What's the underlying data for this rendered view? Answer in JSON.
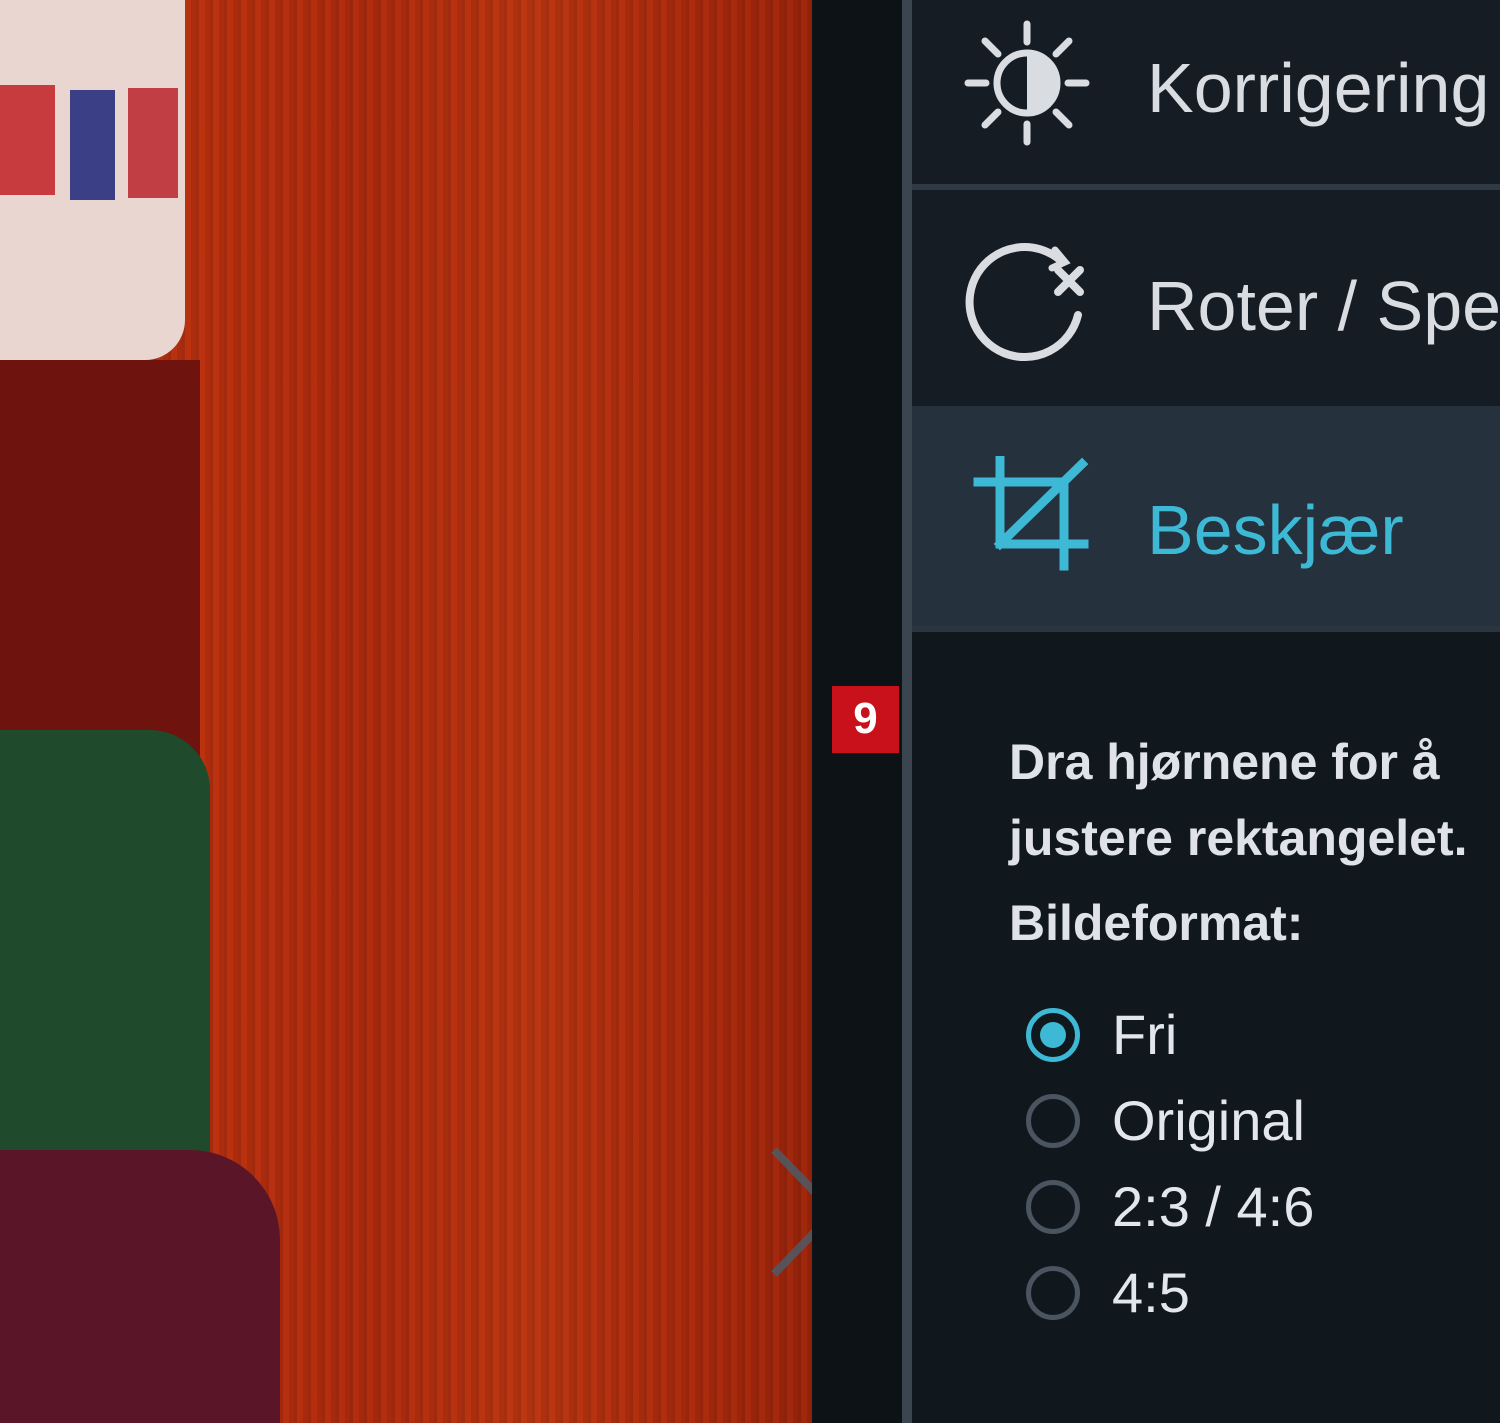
{
  "photo_viewer": {
    "next_icon": "chevron-right-icon"
  },
  "badge": {
    "number": "9",
    "color": "#c8111a"
  },
  "tools": [
    {
      "label": "Korrigering",
      "icon": "brightness-icon",
      "active": false
    },
    {
      "label": "Roter / Speil",
      "icon": "rotate-icon",
      "active": false
    },
    {
      "label": "Beskjær",
      "icon": "crop-icon",
      "active": true
    }
  ],
  "crop": {
    "instruction": "Dra hjørnene for å justere rektangelet.",
    "format_label": "Bildeformat:",
    "options": [
      {
        "label": "Fri",
        "selected": true
      },
      {
        "label": "Original",
        "selected": false
      },
      {
        "label": "2:3 / 4:6",
        "selected": false
      },
      {
        "label": "4:5",
        "selected": false
      }
    ]
  },
  "colors": {
    "accent": "#3db9d6",
    "panel_bg": "#141b22",
    "text": "#dfe3e7"
  }
}
